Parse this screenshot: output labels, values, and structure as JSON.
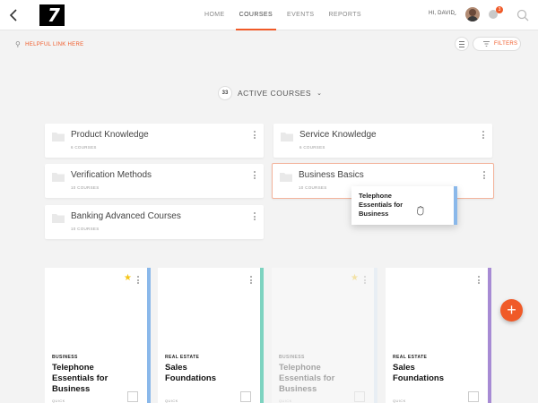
{
  "nav": {
    "items": [
      {
        "label": "HOME"
      },
      {
        "label": "COURSES"
      },
      {
        "label": "EVENTS"
      },
      {
        "label": "REPORTS"
      }
    ],
    "active": "COURSES"
  },
  "user": {
    "greeting": "HI, DAVID",
    "notification_count": "3"
  },
  "subbar": {
    "helpful_link": "HELPFUL LINK HERE",
    "filters_label": "FILTERS"
  },
  "active_courses": {
    "count": "33",
    "label": "ACTIVE COURSES"
  },
  "folders": [
    {
      "title": "Product Knowledge",
      "count": "6 COURSES"
    },
    {
      "title": "Service Knowledge",
      "count": "6 COURSES"
    },
    {
      "title": "Verification Methods",
      "count": "10 COURSES"
    },
    {
      "title": "Business Basics",
      "count": "10 COURSES"
    },
    {
      "title": "Banking Advanced Courses",
      "count": "10 COURSES"
    }
  ],
  "drag_card": {
    "title": "Telephone Essentials for Business"
  },
  "cards": [
    {
      "category": "BUSINESS",
      "title": "Telephone Essentials for Business",
      "type": "QUICK",
      "accent": "#8ab8ea",
      "starred": true
    },
    {
      "category": "REAL ESTATE",
      "title": "Sales Foundations",
      "type": "QUICK",
      "accent": "#7dd3c0",
      "starred": false
    },
    {
      "category": "BUSINESS",
      "title": "Telephone Essentials for Business",
      "type": "QUICK",
      "accent": "#d6e6f7",
      "starred": true
    },
    {
      "category": "REAL ESTATE",
      "title": "Sales Foundations",
      "type": "QUICK",
      "accent": "#a78bd4",
      "starred": false
    }
  ],
  "colors": {
    "accent": "#f05a28",
    "star": "#f5c518"
  },
  "fab": {
    "symbol": "+"
  }
}
